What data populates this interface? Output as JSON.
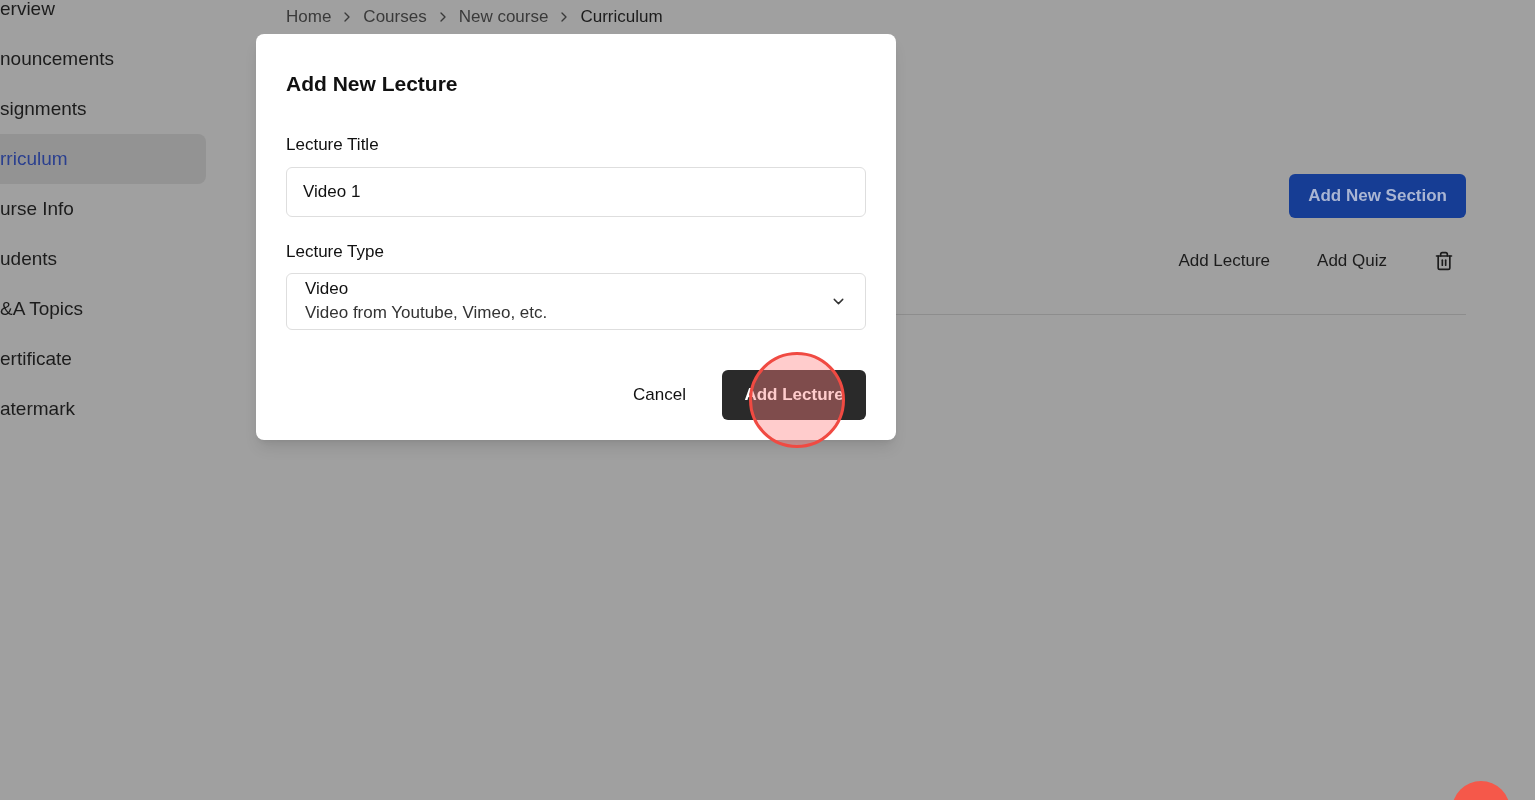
{
  "sidebar": {
    "items": [
      {
        "label": "erview",
        "selected": false
      },
      {
        "label": "nouncements",
        "selected": false
      },
      {
        "label": "signments",
        "selected": false
      },
      {
        "label": "rriculum",
        "selected": true
      },
      {
        "label": "urse Info",
        "selected": false
      },
      {
        "label": "udents",
        "selected": false
      },
      {
        "label": "&A Topics",
        "selected": false
      },
      {
        "label": "ertificate",
        "selected": false
      },
      {
        "label": "atermark",
        "selected": false
      }
    ]
  },
  "breadcrumbs": [
    "Home",
    "Courses",
    "New course",
    "Curriculum"
  ],
  "add_section_button": "Add New Section",
  "section_actions": [
    "Add Lecture",
    "Add Quiz"
  ],
  "dialog": {
    "title": "Add New Lecture",
    "title_label": "Lecture Title",
    "title_value": "Video 1",
    "type_label": "Lecture Type",
    "type_value": "Video",
    "type_description": "Video from Youtube, Vimeo, etc.",
    "cancel": "Cancel",
    "submit": "Add Lecture"
  }
}
